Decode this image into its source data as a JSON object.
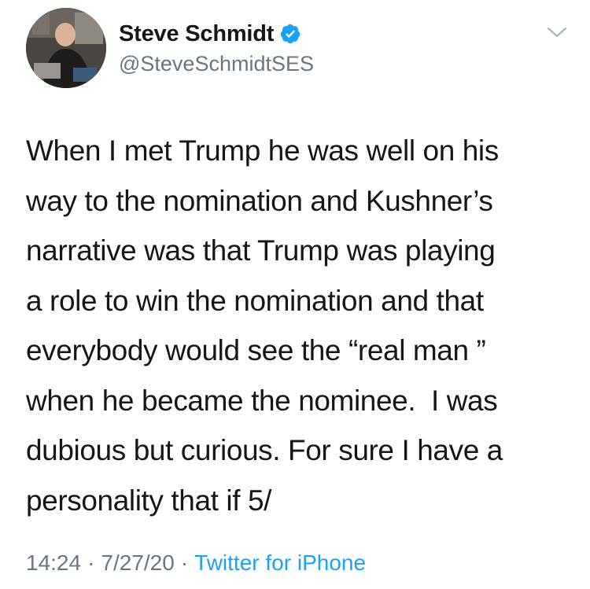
{
  "tweet": {
    "author": {
      "display_name": "Steve Schmidt",
      "handle": "@SteveSchmidtSES",
      "verified": true
    },
    "body_lines": [
      "When I met Trump he was well on his",
      "way to the nomination and Kushner’s",
      "narrative was that Trump was playing",
      "a role to win the nomination and that",
      "everybody would see the “real man ”",
      "when he became the nominee.  I was",
      "dubious but curious. For sure I have a",
      "personality that if 5/"
    ],
    "meta": {
      "time": "14:24",
      "date": "7/27/20",
      "separator": "·",
      "source": "Twitter for iPhone"
    }
  },
  "colors": {
    "text": "#14171a",
    "secondary": "#657786",
    "link": "#1da1f2",
    "verified": "#1da1f2"
  },
  "icons": {
    "verified": "verified-badge-icon",
    "menu": "chevron-down-icon"
  }
}
